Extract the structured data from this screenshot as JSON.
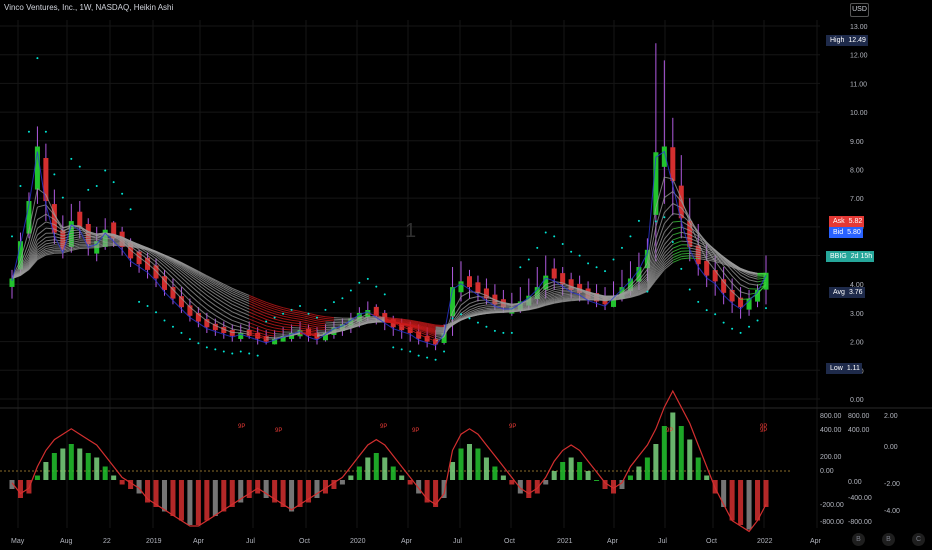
{
  "header": {
    "title": "Vinco Ventures, Inc., 1W, NASDAQ, Heikin Ashi",
    "currency": "USD"
  },
  "watermark": "1",
  "price_tags": {
    "high": {
      "label": "High",
      "value": "12.49"
    },
    "ask": {
      "label": "Ask",
      "value": "5.82"
    },
    "bid": {
      "label": "Bid",
      "value": "5.80"
    },
    "bbig": {
      "label": "BBIG",
      "value": "2d 15h"
    },
    "avg": {
      "label": "Avg",
      "value": "3.76"
    },
    "low": {
      "label": "Low",
      "value": "1.11"
    }
  },
  "colors": {
    "background": "#000000",
    "bull": "#22c32e",
    "bear": "#d32f2f",
    "wick_purple": "#b05ae0",
    "ribbon_red": "#cc1b1b",
    "ribbon_gray": "#9c9c9c",
    "ribbon_green": "#3fd13f",
    "dots": "#00e5d4",
    "blue_line": "#2c35d6",
    "grid": "#161616",
    "high_tag": "#1e2a4a",
    "ask_tag": "#e53935",
    "bid_tag": "#2962ff",
    "bbig_tag": "#26a69a",
    "avg_tag": "#1e2a4a",
    "low_tag": "#1e2a4a"
  },
  "bottom_buttons": [
    "B",
    "B",
    "C"
  ],
  "chart_data": {
    "type": "candlestick",
    "title": "Vinco Ventures, Inc., 1W, NASDAQ, Heikin Ashi",
    "currency": "USD",
    "price_axis": {
      "ticks": [
        "13.00",
        "12.00",
        "11.00",
        "10.00",
        "9.00",
        "8.00",
        "7.00",
        "6.00",
        "5.00",
        "4.00",
        "3.00",
        "2.00",
        "1.00",
        "0.00"
      ],
      "range": [
        0,
        13
      ],
      "scale": "log"
    },
    "time_axis": {
      "ticks": [
        "May",
        "Aug",
        "22",
        "2019",
        "Apr",
        "Jul",
        "Oct",
        "2020",
        "Apr",
        "Jul",
        "Oct",
        "2021",
        "Apr",
        "Jul",
        "Oct",
        "2022",
        "Apr"
      ]
    },
    "candles_hlc": [
      [
        4.5,
        3.5,
        4.2
      ],
      [
        5.8,
        4.3,
        5.5
      ],
      [
        7.2,
        5.6,
        6.9
      ],
      [
        9.5,
        6.8,
        8.8
      ],
      [
        8.9,
        6.2,
        6.9
      ],
      [
        7.3,
        5.4,
        5.8
      ],
      [
        6.4,
        4.9,
        5.2
      ],
      [
        6.8,
        5.1,
        6.2
      ],
      [
        6.9,
        5.6,
        6.0
      ],
      [
        6.3,
        5.0,
        5.4
      ],
      [
        6.0,
        4.8,
        5.5
      ],
      [
        6.3,
        5.2,
        5.9
      ],
      [
        6.2,
        5.3,
        5.6
      ],
      [
        6.0,
        5.0,
        5.3
      ],
      [
        5.6,
        4.6,
        4.9
      ],
      [
        5.2,
        4.4,
        4.7
      ],
      [
        5.1,
        4.2,
        4.5
      ],
      [
        4.9,
        3.9,
        4.2
      ],
      [
        4.5,
        3.6,
        3.8
      ],
      [
        4.2,
        3.3,
        3.5
      ],
      [
        3.9,
        3.0,
        3.2
      ],
      [
        3.5,
        2.7,
        2.9
      ],
      [
        3.2,
        2.5,
        2.7
      ],
      [
        3.0,
        2.3,
        2.5
      ],
      [
        2.8,
        2.2,
        2.4
      ],
      [
        2.7,
        2.1,
        2.3
      ],
      [
        2.6,
        2.0,
        2.2
      ],
      [
        2.6,
        2.0,
        2.3
      ],
      [
        2.7,
        2.1,
        2.2
      ],
      [
        2.5,
        1.9,
        2.1
      ],
      [
        2.4,
        1.9,
        2.0
      ],
      [
        2.4,
        1.9,
        2.1
      ],
      [
        2.5,
        2.0,
        2.2
      ],
      [
        2.6,
        2.0,
        2.3
      ],
      [
        2.7,
        2.1,
        2.4
      ],
      [
        2.6,
        2.0,
        2.2
      ],
      [
        2.5,
        1.9,
        2.1
      ],
      [
        2.6,
        2.0,
        2.3
      ],
      [
        2.7,
        2.1,
        2.5
      ],
      [
        2.8,
        2.2,
        2.6
      ],
      [
        3.0,
        2.3,
        2.8
      ],
      [
        3.2,
        2.5,
        3.0
      ],
      [
        3.4,
        2.7,
        3.1
      ],
      [
        3.3,
        2.6,
        2.9
      ],
      [
        3.1,
        2.4,
        2.7
      ],
      [
        2.9,
        2.2,
        2.5
      ],
      [
        2.8,
        2.1,
        2.4
      ],
      [
        2.7,
        2.0,
        2.3
      ],
      [
        2.6,
        1.9,
        2.1
      ],
      [
        2.5,
        1.8,
        2.0
      ],
      [
        2.4,
        1.7,
        1.9
      ],
      [
        2.6,
        1.9,
        2.3
      ],
      [
        4.6,
        2.2,
        3.9
      ],
      [
        4.8,
        3.4,
        4.1
      ],
      [
        4.5,
        3.5,
        3.9
      ],
      [
        4.3,
        3.4,
        3.7
      ],
      [
        4.2,
        3.3,
        3.5
      ],
      [
        4.0,
        3.1,
        3.3
      ],
      [
        3.8,
        3.0,
        3.2
      ],
      [
        3.7,
        2.9,
        3.2
      ],
      [
        3.9,
        3.0,
        3.4
      ],
      [
        4.2,
        3.1,
        3.6
      ],
      [
        4.6,
        3.3,
        3.9
      ],
      [
        5.0,
        3.5,
        4.3
      ],
      [
        4.9,
        3.8,
        4.2
      ],
      [
        4.6,
        3.6,
        4.0
      ],
      [
        4.4,
        3.5,
        3.8
      ],
      [
        4.3,
        3.4,
        3.7
      ],
      [
        4.1,
        3.3,
        3.5
      ],
      [
        4.0,
        3.2,
        3.4
      ],
      [
        3.9,
        3.1,
        3.3
      ],
      [
        4.1,
        3.2,
        3.6
      ],
      [
        4.5,
        3.4,
        3.9
      ],
      [
        4.8,
        3.6,
        4.2
      ],
      [
        5.1,
        3.8,
        4.6
      ],
      [
        5.6,
        4.1,
        5.2
      ],
      [
        12.4,
        4.8,
        8.6
      ],
      [
        11.8,
        6.8,
        8.8
      ],
      [
        9.8,
        6.4,
        7.6
      ],
      [
        8.5,
        5.6,
        6.3
      ],
      [
        7.0,
        4.8,
        5.3
      ],
      [
        6.1,
        4.3,
        4.7
      ],
      [
        5.4,
        3.9,
        4.3
      ],
      [
        5.0,
        3.6,
        4.1
      ],
      [
        4.6,
        3.3,
        3.7
      ],
      [
        4.2,
        3.0,
        3.4
      ],
      [
        3.9,
        2.8,
        3.2
      ],
      [
        3.8,
        2.9,
        3.5
      ],
      [
        4.0,
        3.2,
        3.8
      ],
      [
        5.0,
        3.3,
        4.4
      ]
    ],
    "oscillator": {
      "left_axis_ticks": [
        "800.00",
        "400.00",
        "200.00",
        "0.00",
        "-200.00",
        "-800.00"
      ],
      "right_axis_ticks": [
        "2.00",
        "0.00",
        "-2.00",
        "-4.00"
      ],
      "right_axis_inner_ticks": [
        "800.00",
        "400.00",
        "0.00",
        "-400.00",
        "-800.00"
      ],
      "histogram": [
        -0.2,
        -0.4,
        -0.3,
        0.1,
        0.4,
        0.6,
        0.7,
        0.8,
        0.7,
        0.6,
        0.5,
        0.3,
        0.1,
        -0.1,
        -0.2,
        -0.3,
        -0.5,
        -0.6,
        -0.7,
        -0.8,
        -0.9,
        -1.0,
        -1.0,
        -0.9,
        -0.8,
        -0.7,
        -0.6,
        -0.5,
        -0.4,
        -0.3,
        -0.4,
        -0.5,
        -0.6,
        -0.7,
        -0.6,
        -0.5,
        -0.4,
        -0.3,
        -0.2,
        -0.1,
        0.1,
        0.3,
        0.5,
        0.6,
        0.5,
        0.3,
        0.1,
        -0.1,
        -0.3,
        -0.5,
        -0.6,
        -0.4,
        0.4,
        0.7,
        0.8,
        0.7,
        0.5,
        0.3,
        0.1,
        -0.1,
        -0.3,
        -0.4,
        -0.3,
        -0.1,
        0.2,
        0.4,
        0.5,
        0.4,
        0.2,
        0.0,
        -0.2,
        -0.3,
        -0.2,
        0.1,
        0.3,
        0.5,
        0.8,
        1.2,
        1.5,
        1.2,
        0.9,
        0.5,
        0.1,
        -0.3,
        -0.6,
        -0.9,
        -1.0,
        -1.1,
        -0.9,
        -0.6
      ],
      "markers": [
        "9P",
        "9P",
        "9P",
        "9P",
        "9P",
        "9P",
        "9P",
        "9P"
      ]
    }
  }
}
